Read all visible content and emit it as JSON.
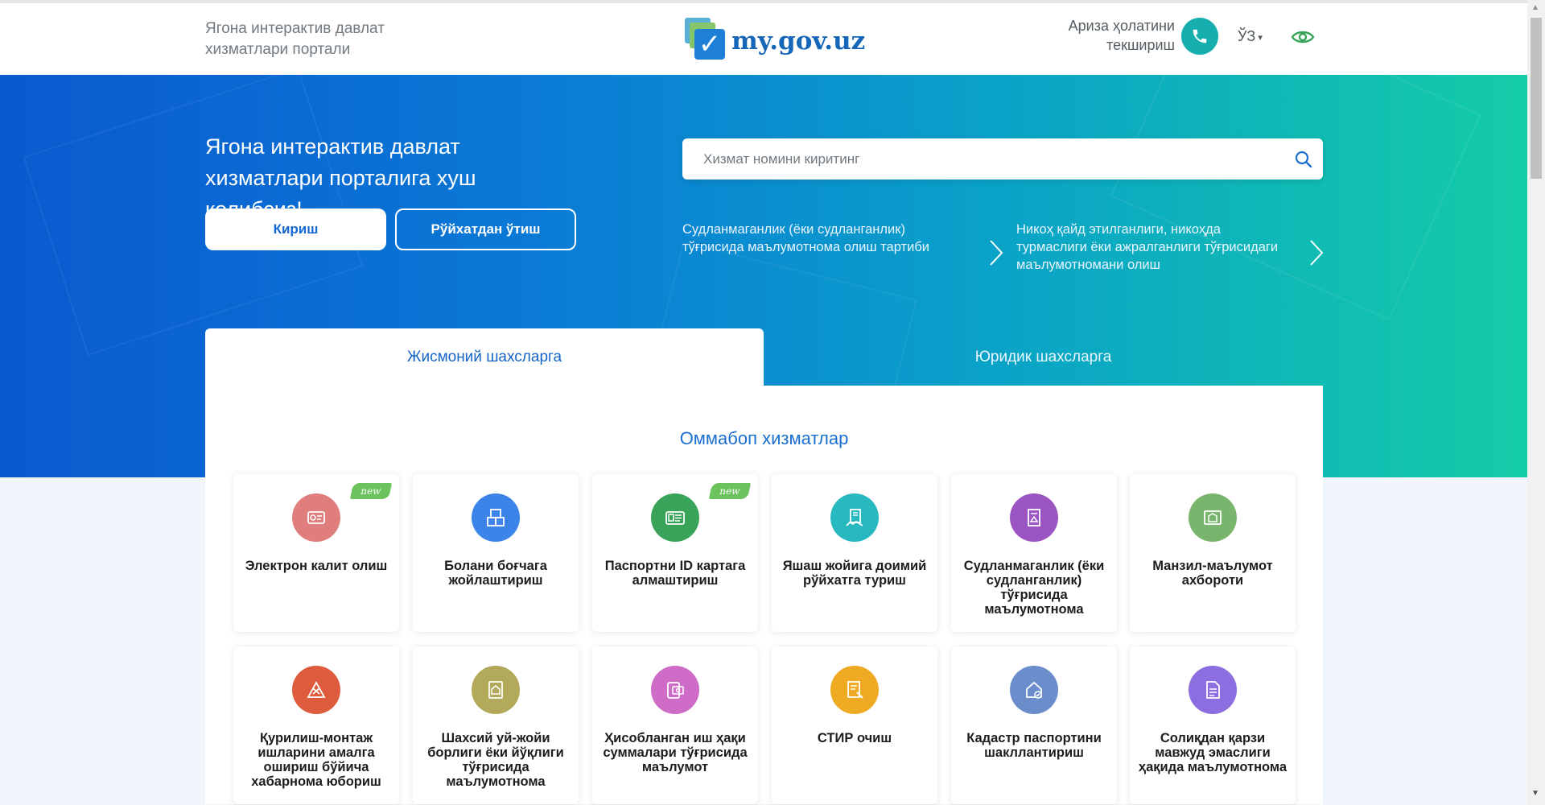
{
  "header": {
    "tagline": "Ягона интерактив давлат хизматлари портали",
    "logo_text": "my.gov.uz",
    "status_check_label": "Ариза ҳолатини текшириш",
    "language": "ЎЗ"
  },
  "hero": {
    "welcome": "Ягона интерактив давлат хизматлари порталига хуш келибсиз!",
    "login_button": "Кириш",
    "register_button": "Рўйхатдан ўтиш",
    "search_placeholder": "Хизмат номини киритинг",
    "promos": [
      "Судланмаганлик (ёки судланганлик) тўғрисида маълумотнома олиш тартиби",
      "Никоҳ қайд этилганлиги, никоҳда турмаслиги ёки ажралганлиги тўғрисидаги маълумотномани олиш"
    ]
  },
  "tabs": {
    "individuals": "Жисмоний шахсларга",
    "legal": "Юридик шахсларга"
  },
  "popular": {
    "title": "Оммабоп хизматлар",
    "badge_new": "new",
    "services": [
      {
        "label": "Электрон калит олиш",
        "icon": "e-key-icon",
        "color": "#e07d7d",
        "new": true
      },
      {
        "label": "Болани боғчага жойлаштириш",
        "icon": "kindergarten-blocks-icon",
        "color": "#3c84ea",
        "new": false
      },
      {
        "label": "Паспортни ID картага алмаштириш",
        "icon": "id-card-icon",
        "color": "#3aa35a",
        "new": true
      },
      {
        "label": "Яшаш жойига доимий рўйхатга туриш",
        "icon": "residence-registration-icon",
        "color": "#27b8c0",
        "new": false
      },
      {
        "label": "Судланмаганлик (ёки судланганлик) тўғрисида маълумотнома",
        "icon": "criminal-record-icon",
        "color": "#9b55c2",
        "new": false
      },
      {
        "label": "Манзил-маълумот ахбороти",
        "icon": "address-info-icon",
        "color": "#7ab56e",
        "new": false
      },
      {
        "label": "Қурилиш-монтаж ишларини амалга ошириш бўйича хабарнома юбориш",
        "icon": "construction-tools-icon",
        "color": "#de5b3e",
        "new": false
      },
      {
        "label": "Шахсий уй-жойи борлиги ёки йўқлиги тўғрисида маълумотнома",
        "icon": "house-document-icon",
        "color": "#b2a95a",
        "new": false
      },
      {
        "label": "Ҳисобланган иш ҳақи суммалари тўғрисида маълумот",
        "icon": "salary-info-icon",
        "color": "#cf6cc8",
        "new": false
      },
      {
        "label": "СТИР очиш",
        "icon": "tax-id-icon",
        "color": "#eeaa22",
        "new": false
      },
      {
        "label": "Кадастр паспортини шакллантириш",
        "icon": "cadastre-house-icon",
        "color": "#6c8dcb",
        "new": false
      },
      {
        "label": "Солиқдан қарзи мавжуд эмаслиги ҳақида маълумотнома",
        "icon": "tax-debt-document-icon",
        "color": "#8c6ee0",
        "new": false
      }
    ]
  }
}
